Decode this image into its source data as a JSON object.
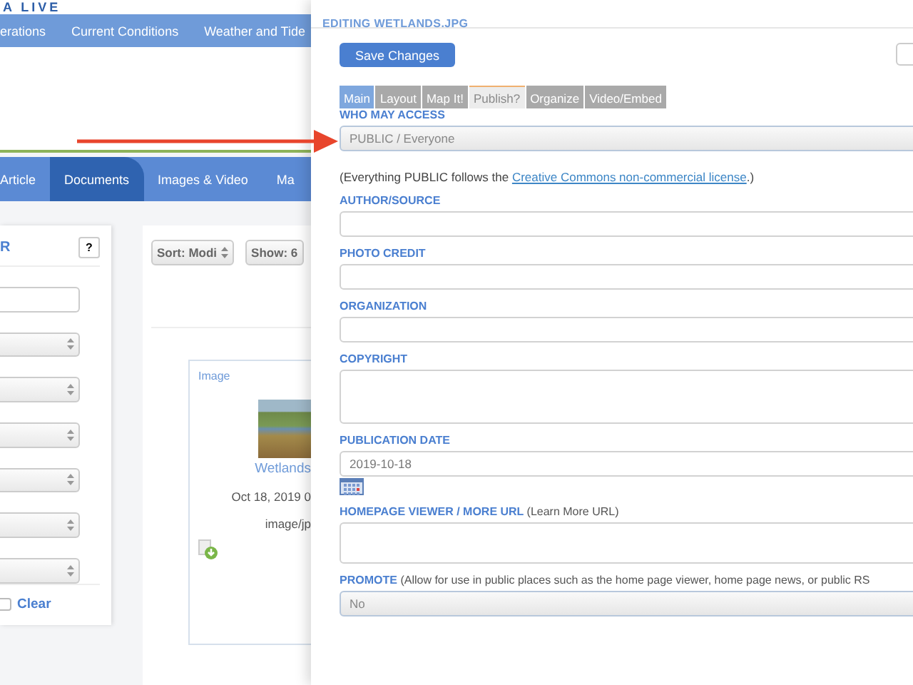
{
  "site": {
    "logo": "A LIVE",
    "nav": [
      "erations",
      "Current Conditions",
      "Weather and Tide"
    ],
    "tabs": [
      {
        "label": "Article",
        "selected": false
      },
      {
        "label": "Documents",
        "selected": true
      },
      {
        "label": "Images & Video",
        "selected": false
      },
      {
        "label": "Ma",
        "selected": false
      }
    ],
    "filter": {
      "title": "R",
      "help": "?",
      "clear": "Clear",
      "checked": false
    },
    "toolbar": [
      "Sort: Modi",
      "Show: 6"
    ],
    "card": {
      "type": "Image",
      "name": "Wetlands",
      "date": "Oct 18, 2019 0",
      "mime": "image/jp"
    }
  },
  "editor": {
    "title": "EDITING WETLANDS.JPG",
    "save": "Save Changes",
    "tabs": [
      {
        "label": "Main",
        "selected": false,
        "kind": "primary"
      },
      {
        "label": "Layout",
        "selected": false,
        "kind": "normal"
      },
      {
        "label": "Map It!",
        "selected": false,
        "kind": "normal"
      },
      {
        "label": "Publish?",
        "selected": true,
        "kind": "normal"
      },
      {
        "label": "Organize",
        "selected": false,
        "kind": "normal"
      },
      {
        "label": "Video/Embed",
        "selected": false,
        "kind": "normal"
      }
    ],
    "fields": [
      {
        "kind": "select",
        "label": "WHO MAY ACCESS",
        "value": "PUBLIC / Everyone",
        "help_before": "(Everything PUBLIC follows the ",
        "help_link": "Creative Commons non-commercial license",
        "help_after": ".)"
      },
      {
        "kind": "text",
        "label": "AUTHOR/SOURCE"
      },
      {
        "kind": "text",
        "label": "PHOTO CREDIT"
      },
      {
        "kind": "text",
        "label": "ORGANIZATION"
      },
      {
        "kind": "textarea",
        "label": "COPYRIGHT"
      },
      {
        "kind": "date",
        "label": "PUBLICATION DATE",
        "value": "2019-10-18"
      },
      {
        "kind": "textarea",
        "label": "HOMEPAGE VIEWER / MORE URL",
        "note": "(Learn More URL)"
      },
      {
        "kind": "select",
        "label": "PROMOTE",
        "note": "(Allow for use in public places such as the home page viewer, home page news, or public RS",
        "value": "No"
      }
    ]
  }
}
